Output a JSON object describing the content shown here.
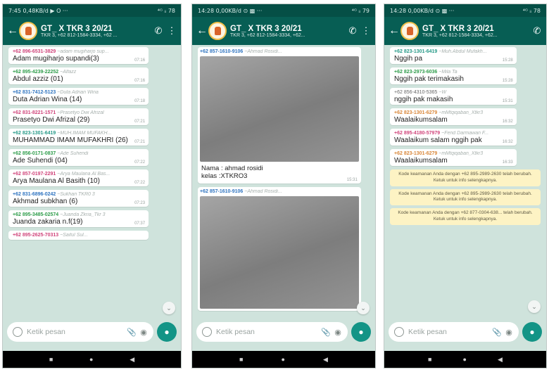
{
  "phone1": {
    "status_time": "7:45",
    "status_left": "7:45 0,48KB/d ▶ O ···",
    "status_right": "⁴ᴳ ᵢᵢ 78",
    "title": "GT_ X TKR 3 20/21",
    "subtitle": "TKR 3, +62 812-1584-3334, +62 ...",
    "messages": [
      {
        "phone": "+62 896-6531-3829",
        "name": "~adam mugiharjo sup...",
        "text": "Adam mugiharjo supandi(3)",
        "time": "07:16",
        "color": "c-pink"
      },
      {
        "phone": "+62 895-4239-22252",
        "name": "~Alfazz",
        "text": "Abdul azziz (01)",
        "time": "07:16",
        "color": "c-green"
      },
      {
        "phone": "+62 831-7412-5123",
        "name": "~Duta Adrian Wina",
        "text": "Duta Adrian Wina (14)",
        "time": "07:18",
        "color": "c-blue"
      },
      {
        "phone": "+62 831-8221-1571",
        "name": "~Prasetyo Dwi Afrizal",
        "text": "Prasetyo Dwi Afrizal (29)",
        "time": "07:21",
        "color": "c-pink"
      },
      {
        "phone": "+62 823-1301-6419",
        "name": "~MUH.IMAM MUFAKH...",
        "text": "MUHAMMAD IMAM MUFAKHRI (26)",
        "time": "07:21",
        "color": "c-teal"
      },
      {
        "phone": "+62 856-0171-0837",
        "name": "~Ade Suhendi",
        "text": "Ade Suhendi  (04)",
        "time": "07:22",
        "color": "c-green"
      },
      {
        "phone": "+62 857-0197-2291",
        "name": "~Arya Maulana Al Bas...",
        "text": "Arya Maulana Al Basith (10)",
        "time": "07:22",
        "color": "c-pink"
      },
      {
        "phone": "+62 831-6896-0242",
        "name": "~Sukhan TKR0 3",
        "text": "Akhmad subkhan (6)",
        "time": "07:23",
        "color": "c-blue"
      },
      {
        "phone": "+62 895-3485-02574",
        "name": "~Juanda Zkria_Tkr 3",
        "text": "Juanda zakaria n.f(19)",
        "time": "07:37",
        "color": "c-green"
      },
      {
        "phone": "+62 895-2625-70313",
        "name": "~Saiful Sul...",
        "text": "",
        "time": "",
        "color": "c-pink"
      }
    ],
    "placeholder": "Ketik pesan"
  },
  "phone2": {
    "status_left": "14:28 0,00KB/d ⊙ ▩ ···",
    "status_right": "⁴ᴳ ᵢᵢ 79",
    "title": "GT_ X TKR 3 20/21",
    "subtitle": "TKR 3, +62 812-1584-3334, +62...",
    "msg1_phone": "+62 857-1610-9106",
    "msg1_name": "~Ahmad Rosidi...",
    "caption_line1": "Nama : ahmad rosidi",
    "caption_line2": "kelas :XTKRO3",
    "msg1_time": "15:31",
    "msg2_phone": "+62 857-1610-9106",
    "msg2_name": "~Ahmad Rosidi...",
    "placeholder": "Ketik pesan"
  },
  "phone3": {
    "status_left": "14:28 0,00KB/d ⊙ ▩ ···",
    "status_right": "⁴ᴳ ᵢᵢ 78",
    "title": "GT_ X TKR 3 20/21",
    "subtitle": "TKR 3, +62 812-1584-3334, +62...",
    "messages": [
      {
        "phone": "+62 823-1301-6419",
        "name": "~Muh.Abdul Mufakh...",
        "text": "Nggih pa",
        "time": "15:28",
        "color": "c-teal"
      },
      {
        "phone": "+62 823-2973-6036",
        "name": "~Mila Ta",
        "text": "Nggih pak terimakasih",
        "time": "15:28",
        "color": "c-green"
      },
      {
        "phone": "+62 856-4310-5365",
        "name": "~W",
        "text": "nggih pak makasih",
        "time": "15:31",
        "color": "c-gray"
      },
      {
        "phone": "+62 823-1301-6279",
        "name": "~mMtqiqaban_Xtkr3",
        "text": "Waalaikumsalam",
        "time": "16:32",
        "color": "c-orange"
      },
      {
        "phone": "+62 895-4180-57979",
        "name": "~Fend Darmawan F...",
        "text": "Waalaikum salam nggih pak",
        "time": "16:32",
        "color": "c-pink"
      },
      {
        "phone": "+62 823-1301-6279",
        "name": "~mMtqiqaban_Xtkr3",
        "text": "Waalaikumsalam",
        "time": "16:33",
        "color": "c-orange"
      }
    ],
    "notices": [
      "Kode keamanan Anda dengan +62 895-2989-2630 telah berubah. Ketuk untuk info selengkapnya.",
      "Kode keamanan Anda dengan +62 895-2989-2630 telah berubah. Ketuk untuk info selengkapnya.",
      "Kode keamanan Anda dengan +62 877-0304-638... telah berubah. Ketuk untuk info selengkapnya."
    ],
    "placeholder": "Ketik pesan"
  },
  "icons": {
    "back": "back-arrow-icon",
    "call": "call-add-icon",
    "menu": "kebab-menu-icon",
    "emoji": "emoji-icon",
    "attach": "paperclip-icon",
    "camera": "camera-icon",
    "mic": "microphone-icon",
    "scroll": "scroll-down-icon"
  },
  "colors": {
    "header": "#075e54",
    "statusbar": "#054f46",
    "chat_bg": "#cfe3dc",
    "mic": "#139486",
    "notice_bg": "#fdf3c4"
  }
}
